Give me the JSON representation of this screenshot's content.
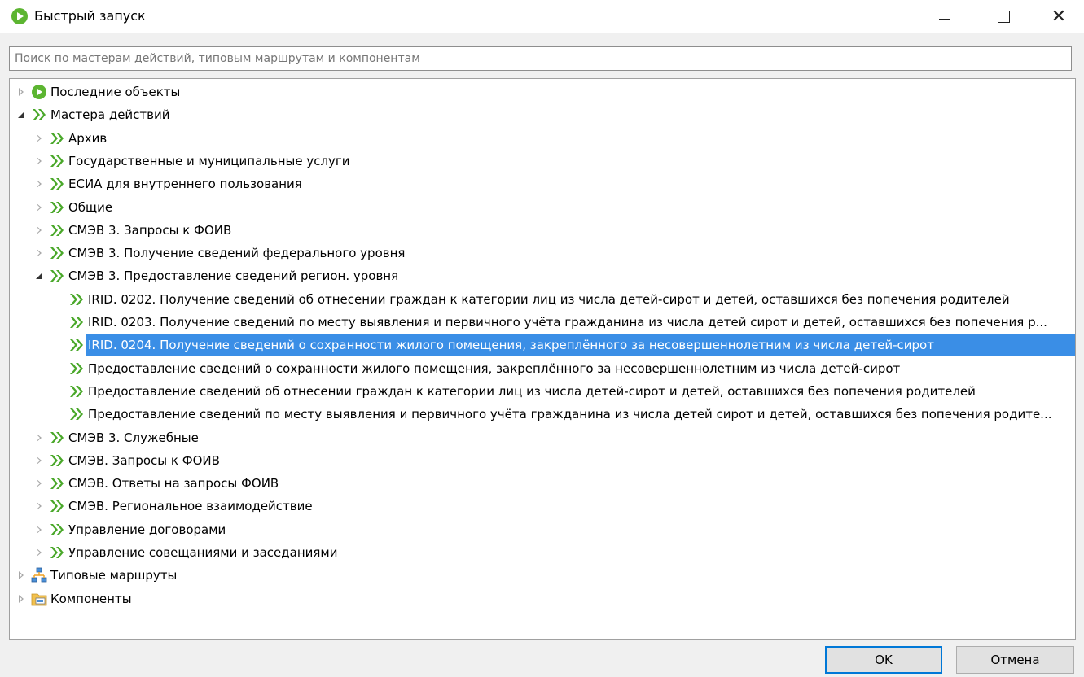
{
  "window": {
    "title": "Быстрый запуск",
    "minimize_glyph": "–",
    "maximize_glyph": "☐",
    "close_glyph": "✕"
  },
  "search": {
    "placeholder": "Поиск по мастерам действий, типовым маршрутам и компонентам",
    "value": ""
  },
  "colors": {
    "accent_green": "#5cb531",
    "selection": "#3a8ee6",
    "ok_border": "#0078d7"
  },
  "tree": [
    {
      "label": "Последние объекты",
      "level": 0,
      "toggle": "collapsed",
      "icon": "recent-play-icon"
    },
    {
      "label": "Мастера действий",
      "level": 0,
      "toggle": "expanded",
      "icon": "double-chevron-icon"
    },
    {
      "label": "Архив",
      "level": 1,
      "toggle": "collapsed",
      "icon": "double-chevron-icon"
    },
    {
      "label": "Государственные и муниципальные услуги",
      "level": 1,
      "toggle": "collapsed",
      "icon": "double-chevron-icon"
    },
    {
      "label": "ЕСИА для внутреннего пользования",
      "level": 1,
      "toggle": "collapsed",
      "icon": "double-chevron-icon"
    },
    {
      "label": "Общие",
      "level": 1,
      "toggle": "collapsed",
      "icon": "double-chevron-icon"
    },
    {
      "label": "СМЭВ 3. Запросы к ФОИВ",
      "level": 1,
      "toggle": "collapsed",
      "icon": "double-chevron-icon"
    },
    {
      "label": "СМЭВ 3. Получение сведений федерального уровня",
      "level": 1,
      "toggle": "collapsed",
      "icon": "double-chevron-icon"
    },
    {
      "label": "СМЭВ 3. Предоставление сведений регион. уровня",
      "level": 1,
      "toggle": "expanded",
      "icon": "double-chevron-icon"
    },
    {
      "label": "IRID. 0202. Получение сведений об отнесении граждан к категории лиц из числа детей-сирот и детей, оставшихся без попечения родителей",
      "level": 2,
      "toggle": "none",
      "icon": "double-chevron-icon"
    },
    {
      "label": "IRID. 0203. Получение сведений по месту выявления и первичного учёта гражданина из числа детей сирот и детей, оставшихся без попечения р...",
      "level": 2,
      "toggle": "none",
      "icon": "double-chevron-icon"
    },
    {
      "label": "IRID. 0204. Получение сведений о сохранности жилого помещения, закреплённого за несовершеннолетним из числа детей-сирот",
      "level": 2,
      "toggle": "none",
      "icon": "double-chevron-icon",
      "selected": true
    },
    {
      "label": "Предоставление сведений о сохранности жилого помещения, закреплённого за несовершеннолетним из числа детей-сирот",
      "level": 2,
      "toggle": "none",
      "icon": "double-chevron-icon"
    },
    {
      "label": "Предоставление сведений об отнесении граждан к категории лиц из числа детей-сирот и детей, оставшихся без попечения родителей",
      "level": 2,
      "toggle": "none",
      "icon": "double-chevron-icon"
    },
    {
      "label": "Предоставление сведений по месту выявления и первичного учёта гражданина из числа детей сирот и детей, оставшихся без попечения родите...",
      "level": 2,
      "toggle": "none",
      "icon": "double-chevron-icon"
    },
    {
      "label": "СМЭВ 3. Служебные",
      "level": 1,
      "toggle": "collapsed",
      "icon": "double-chevron-icon"
    },
    {
      "label": "СМЭВ. Запросы к ФОИВ",
      "level": 1,
      "toggle": "collapsed",
      "icon": "double-chevron-icon"
    },
    {
      "label": "СМЭВ. Ответы на запросы ФОИВ",
      "level": 1,
      "toggle": "collapsed",
      "icon": "double-chevron-icon"
    },
    {
      "label": "СМЭВ. Региональное взаимодействие",
      "level": 1,
      "toggle": "collapsed",
      "icon": "double-chevron-icon"
    },
    {
      "label": "Управление договорами",
      "level": 1,
      "toggle": "collapsed",
      "icon": "double-chevron-icon"
    },
    {
      "label": "Управление совещаниями и заседаниями",
      "level": 1,
      "toggle": "collapsed",
      "icon": "double-chevron-icon"
    },
    {
      "label": "Типовые маршруты",
      "level": 0,
      "toggle": "collapsed",
      "icon": "route-icon"
    },
    {
      "label": "Компоненты",
      "level": 0,
      "toggle": "collapsed",
      "icon": "folder-icon"
    }
  ],
  "buttons": {
    "ok": "OK",
    "cancel": "Отмена"
  }
}
